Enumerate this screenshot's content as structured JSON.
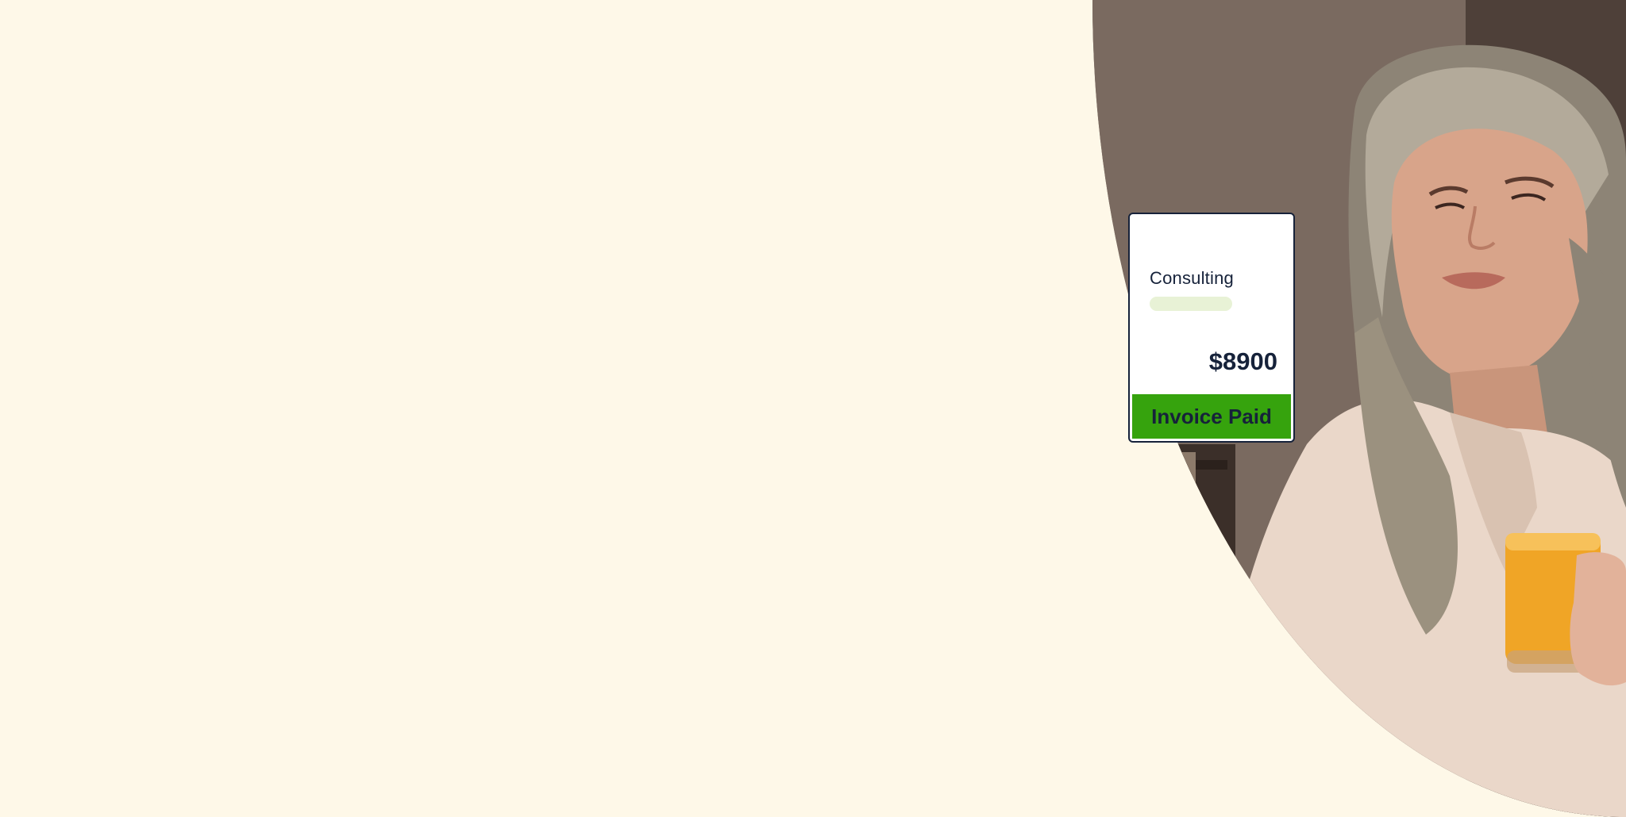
{
  "invoice": {
    "label": "Consulting",
    "amount": "$8900",
    "status": "Invoice Paid"
  },
  "colors": {
    "background": "#fef8e8",
    "status_green": "#36a30d",
    "ink": "#16223a",
    "placeholder": "#e8f2d6"
  },
  "photo": {
    "subject": "woman-with-orange-juice"
  }
}
